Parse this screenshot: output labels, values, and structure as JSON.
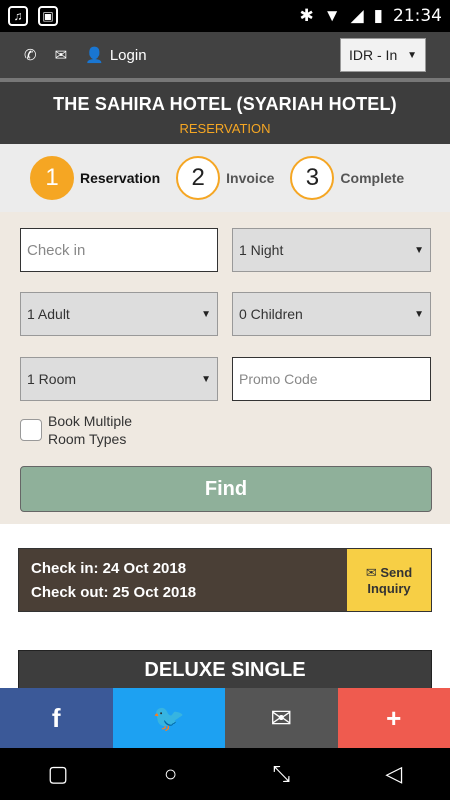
{
  "statusbar": {
    "time": "21:34",
    "icons": [
      "music-icon",
      "app-icon",
      "bluetooth-icon",
      "wifi-icon",
      "signal-icon",
      "battery-icon"
    ]
  },
  "topbar": {
    "login_label": "Login",
    "currency_selected": "IDR - In",
    "icons": [
      "phone-icon",
      "mail-icon",
      "user-icon"
    ]
  },
  "header": {
    "title": "THE SAHIRA HOTEL (SYARIAH HOTEL)",
    "subtitle": "RESERVATION",
    "accent_color": "#f5a623"
  },
  "steps": [
    {
      "num": "1",
      "label": "Reservation",
      "active": true
    },
    {
      "num": "2",
      "label": "Invoice",
      "active": false
    },
    {
      "num": "3",
      "label": "Complete",
      "active": false
    }
  ],
  "form": {
    "checkin_placeholder": "Check in",
    "nights_selected": "1 Night",
    "adults_selected": "1 Adult",
    "children_selected": "0 Children",
    "rooms_selected": "1 Room",
    "promo_placeholder": "Promo Code",
    "multi_room_label_line1": "Book Multiple",
    "multi_room_label_line2": "Room Types",
    "find_label": "Find"
  },
  "summary": {
    "checkin": "Check in: 24 Oct 2018",
    "checkout": "Check out: 25 Oct 2018",
    "inquiry_line1": "Send",
    "inquiry_line2": "Inquiry"
  },
  "room": {
    "title": "DELUXE SINGLE"
  },
  "share": {
    "facebook": "f",
    "plus": "+"
  }
}
